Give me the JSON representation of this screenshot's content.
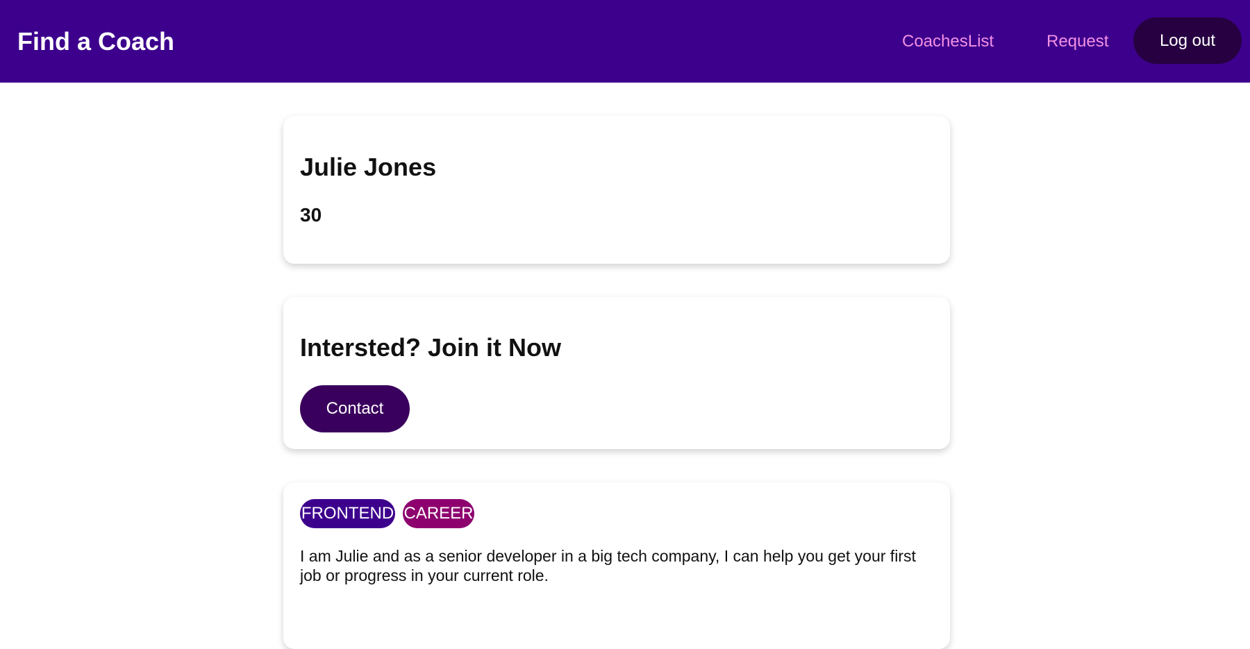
{
  "header": {
    "brand": "Find a Coach",
    "nav": {
      "coaches": "CoachesList",
      "request": "Request"
    },
    "logout_label": "Log out"
  },
  "coach": {
    "name": "Julie Jones",
    "rate": "30"
  },
  "cta": {
    "title": "Intersted? Join it Now",
    "contact_label": "Contact"
  },
  "areas": [
    "FRONTEND",
    "CAREER"
  ],
  "description": "I am Julie and as a senior developer in a big tech company, I can help you get your first job or progress in your current role.",
  "colors": {
    "header_bg": "#3d008d",
    "nav_link": "#f391e3",
    "logout_bg": "#270041",
    "contact_bg": "#3a005d",
    "frontend_badge": "#3d008d",
    "career_badge": "#8d006e"
  }
}
